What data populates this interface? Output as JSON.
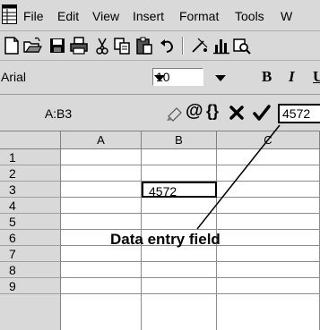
{
  "menu": [
    "File",
    "Edit",
    "View",
    "Insert",
    "Format",
    "Tools",
    "W"
  ],
  "toolbar_icons": [
    "new-document-icon",
    "open-folder-icon",
    "save-disk-icon",
    "print-icon",
    "cut-scissors-icon",
    "copy-icon",
    "paste-icon",
    "undo-icon",
    "draw-icon",
    "chart-icon",
    "find-icon"
  ],
  "format": {
    "font": "Arial",
    "size": "10",
    "bold": "B",
    "italic": "I",
    "underline": "U"
  },
  "formula": {
    "cell_ref": "A:B3",
    "value": "4572"
  },
  "grid": {
    "columns": [
      "A",
      "B",
      "C"
    ],
    "rows": [
      "1",
      "2",
      "3",
      "4",
      "5",
      "6",
      "7",
      "8",
      "9"
    ],
    "active_cell": "4572"
  },
  "annotation": "Data entry field"
}
